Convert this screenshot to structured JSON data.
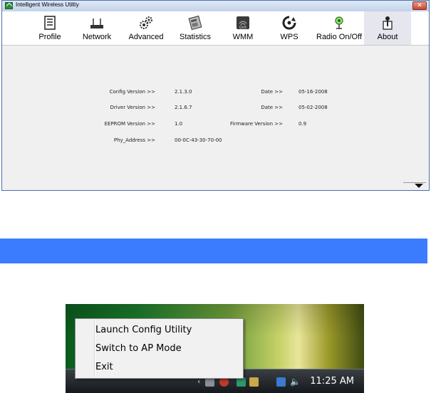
{
  "window": {
    "title": "Intelligent Wireless Utiltiy",
    "close_symbol": "✕"
  },
  "toolbar": {
    "items": [
      {
        "label": "Profile",
        "icon": "profile-icon"
      },
      {
        "label": "Network",
        "icon": "network-icon"
      },
      {
        "label": "Advanced",
        "icon": "advanced-icon"
      },
      {
        "label": "Statistics",
        "icon": "statistics-icon"
      },
      {
        "label": "WMM",
        "icon": "wmm-icon"
      },
      {
        "label": "WPS",
        "icon": "wps-icon"
      },
      {
        "label": "Radio On/Off",
        "icon": "radio-icon"
      },
      {
        "label": "About",
        "icon": "about-icon",
        "active": true
      }
    ]
  },
  "about": {
    "config_version_label": "Config Version >>",
    "config_version": "2.1.3.0",
    "config_date_label": "Date >>",
    "config_date": "05-16-2008",
    "driver_version_label": "Driver Version >>",
    "driver_version": "2.1.6.7",
    "driver_date_label": "Date >>",
    "driver_date": "05-02-2008",
    "eeprom_version_label": "EEPROM Version >>",
    "eeprom_version": "1.0",
    "firmware_version_label": "Firmware Version >>",
    "firmware_version": "0.9",
    "phy_address_label": "Phy_Address >>",
    "phy_address": "00-0C-43-30-70-00"
  },
  "tray_menu": {
    "items": [
      "Launch Config Utility",
      "Switch to AP Mode",
      "Exit"
    ]
  },
  "taskbar": {
    "clock": "11:25 AM"
  },
  "colors": {
    "accent_bar": "#3b7cff",
    "window_border": "#4a6fb0"
  }
}
